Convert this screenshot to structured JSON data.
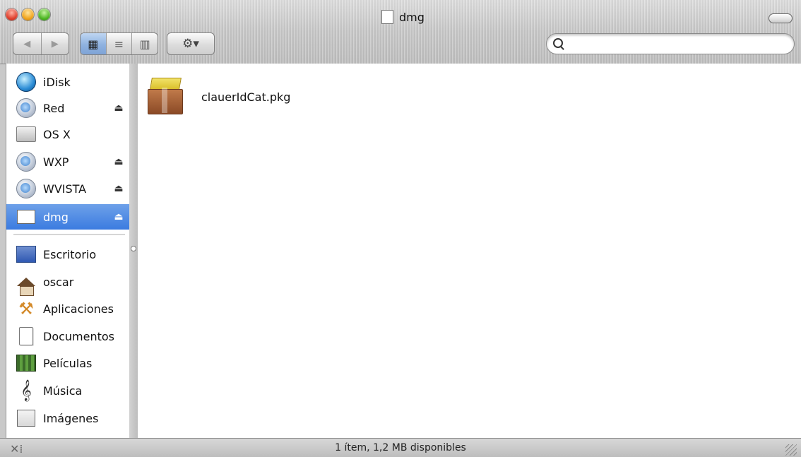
{
  "window": {
    "title": "dmg"
  },
  "toolbar": {
    "nav": [
      "◀",
      "▶"
    ],
    "views": [
      "▦",
      "≡",
      "▥"
    ],
    "action": "⚙▾",
    "search_placeholder": ""
  },
  "sidebar": {
    "devices": [
      {
        "label": "iDisk",
        "icon": "idisk-icon",
        "eject": ""
      },
      {
        "label": "Red",
        "icon": "network-globe-icon",
        "eject": "⏏"
      },
      {
        "label": "OS X",
        "icon": "hard-drive-icon",
        "eject": ""
      },
      {
        "label": "WXP",
        "icon": "network-globe-icon",
        "eject": "⏏"
      },
      {
        "label": "WVISTA",
        "icon": "network-globe-icon",
        "eject": "⏏"
      },
      {
        "label": "dmg",
        "icon": "disk-image-icon",
        "eject": "⏏",
        "selected": true
      }
    ],
    "places": [
      {
        "label": "Escritorio",
        "icon": "desktop-icon"
      },
      {
        "label": "oscar",
        "icon": "home-icon"
      },
      {
        "label": "Aplicaciones",
        "icon": "applications-icon"
      },
      {
        "label": "Documentos",
        "icon": "documents-icon"
      },
      {
        "label": "Películas",
        "icon": "movies-icon"
      },
      {
        "label": "Música",
        "icon": "music-icon"
      },
      {
        "label": "Imágenes",
        "icon": "pictures-icon"
      }
    ]
  },
  "content": {
    "files": [
      {
        "name": "clauerIdCat.pkg",
        "icon": "package-icon"
      }
    ]
  },
  "status": {
    "text": "1 ítem, 1,2 MB disponibles"
  },
  "colors": {
    "selection": "#3b7be0",
    "sidebar_bg": "#ffffff"
  }
}
